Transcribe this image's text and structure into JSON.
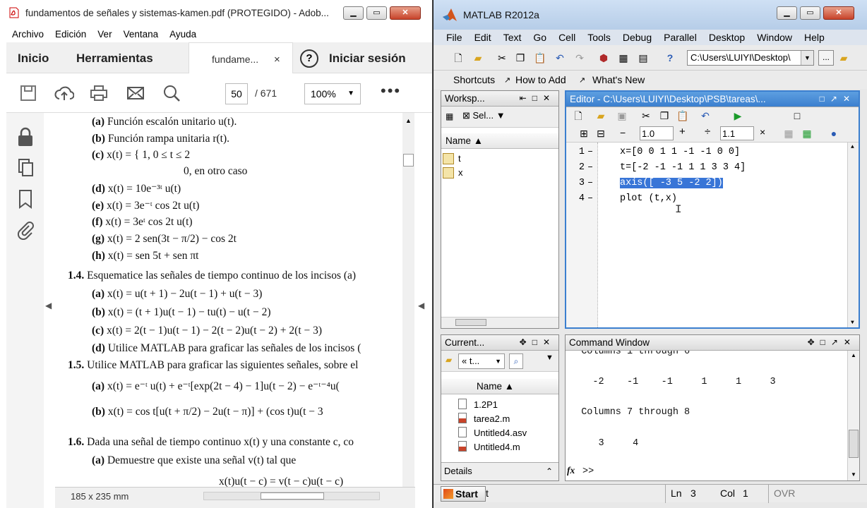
{
  "pdf": {
    "title": "fundamentos de señales y sistemas-kamen.pdf (PROTEGIDO) - Adob...",
    "menu": [
      "Archivo",
      "Edición",
      "Ver",
      "Ventana",
      "Ayuda"
    ],
    "tabs": {
      "home": "Inicio",
      "tools": "Herramientas",
      "document": "fundame...",
      "close": "×",
      "help": "?",
      "signin": "Iniciar sesión"
    },
    "toolbar": {
      "page": "50",
      "page_total": "/ 671",
      "zoom": "100%",
      "more": "•••"
    },
    "status": {
      "dims": "185 x 235 mm"
    },
    "lines": [
      {
        "label": "(a)",
        "text": "Función escalón unitario u(t)."
      },
      {
        "label": "(b)",
        "text": "Función rampa unitaria r(t)."
      },
      {
        "label": "(c)",
        "text": "x(t) = { 1,    0 ≤ t ≤ 2"
      },
      {
        "label": "",
        "text": "0,    en otro caso"
      },
      {
        "label": "(d)",
        "text": "x(t) = 10e⁻³ᵗ u(t)"
      },
      {
        "label": "(e)",
        "text": "x(t) = 3e⁻ᵗ cos 2t u(t)"
      },
      {
        "label": "(f)",
        "text": "x(t) = 3eᵗ cos 2t u(t)"
      },
      {
        "label": "(g)",
        "text": "x(t) = 2 sen(3t − π/2) − cos 2t"
      },
      {
        "label": "(h)",
        "text": "x(t) = sen 5t + sen πt"
      },
      {
        "label": "1.4.",
        "text": "Esquematice las señales de tiempo continuo de los incisos (a)"
      },
      {
        "label": "(a)",
        "text": "x(t) = u(t + 1) − 2u(t − 1) + u(t − 3)"
      },
      {
        "label": "(b)",
        "text": "x(t) = (t + 1)u(t − 1) − tu(t) − u(t − 2)"
      },
      {
        "label": "(c)",
        "text": "x(t) = 2(t − 1)u(t − 1) − 2(t − 2)u(t − 2) + 2(t − 3)"
      },
      {
        "label": "(d)",
        "text": "Utilice MATLAB para graficar las señales de los incisos ("
      },
      {
        "label": "1.5.",
        "text": "Utilice MATLAB para graficar las siguientes señales, sobre el"
      },
      {
        "label": "(a)",
        "text": "x(t) = e⁻ᵗ u(t) + e⁻ᵗ[exp(2t − 4) − 1]u(t − 2) − e⁻ᵗ⁻⁴u("
      },
      {
        "label": "(b)",
        "text": "x(t) = cos t[u(t + π/2) − 2u(t − π)] + (cos t)u(t − 3"
      },
      {
        "label": "1.6.",
        "text": "Dada una señal de tiempo continuo x(t) y una constante c, co"
      },
      {
        "label": "(a)",
        "text": "Demuestre que existe una señal v(t) tal que"
      },
      {
        "label": "",
        "text": "x(t)u(t − c) = v(t − c)u(t − c)"
      }
    ]
  },
  "matlab": {
    "title": "MATLAB  R2012a",
    "menu": [
      "File",
      "Edit",
      "Text",
      "Go",
      "Cell",
      "Tools",
      "Debug",
      "Parallel",
      "Desktop",
      "Window",
      "Help"
    ],
    "current_folder_path": "C:\\Users\\LUIYI\\Desktop\\",
    "shortcuts": [
      "Shortcuts",
      "How to Add",
      "What's New"
    ],
    "workspace": {
      "title": "Worksp...",
      "select_label": "Sel...",
      "col_name": "Name ▲",
      "vars": [
        "t",
        "x"
      ]
    },
    "current_folder": {
      "title": "Current...",
      "path": "« t...",
      "col_name": "Name ▲",
      "files": [
        "1.2P1",
        "tarea2.m",
        "Untitled4.asv",
        "Untitled4.m"
      ],
      "details": "Details"
    },
    "editor": {
      "title": "Editor - C:\\Users\\LUIYI\\Desktop\\PSB\\tareas\\...",
      "step1": "1.0",
      "step2": "1.1",
      "line_numbers": [
        "1",
        "2",
        "3",
        "4"
      ],
      "code": [
        "x=[0 0 1 1 -1 -1 0 0]",
        "t=[-2 -1 -1 1 1 3 3 4]",
        "axis([ -3 5 -2 2])",
        "plot (t,x)"
      ]
    },
    "command_window": {
      "title": "Command Window",
      "lines": [
        "  Columns 1 through 6",
        "",
        "    -2    -1    -1     1     1     3",
        "",
        "  Columns 7 through 8",
        "",
        "     3     4"
      ],
      "prompt": ">>",
      "fx": "fx"
    },
    "status": {
      "start": "Start",
      "typed": "t",
      "ln_label": "Ln",
      "ln": "3",
      "col_label": "Col",
      "col": "1",
      "ovr": "OVR"
    }
  }
}
